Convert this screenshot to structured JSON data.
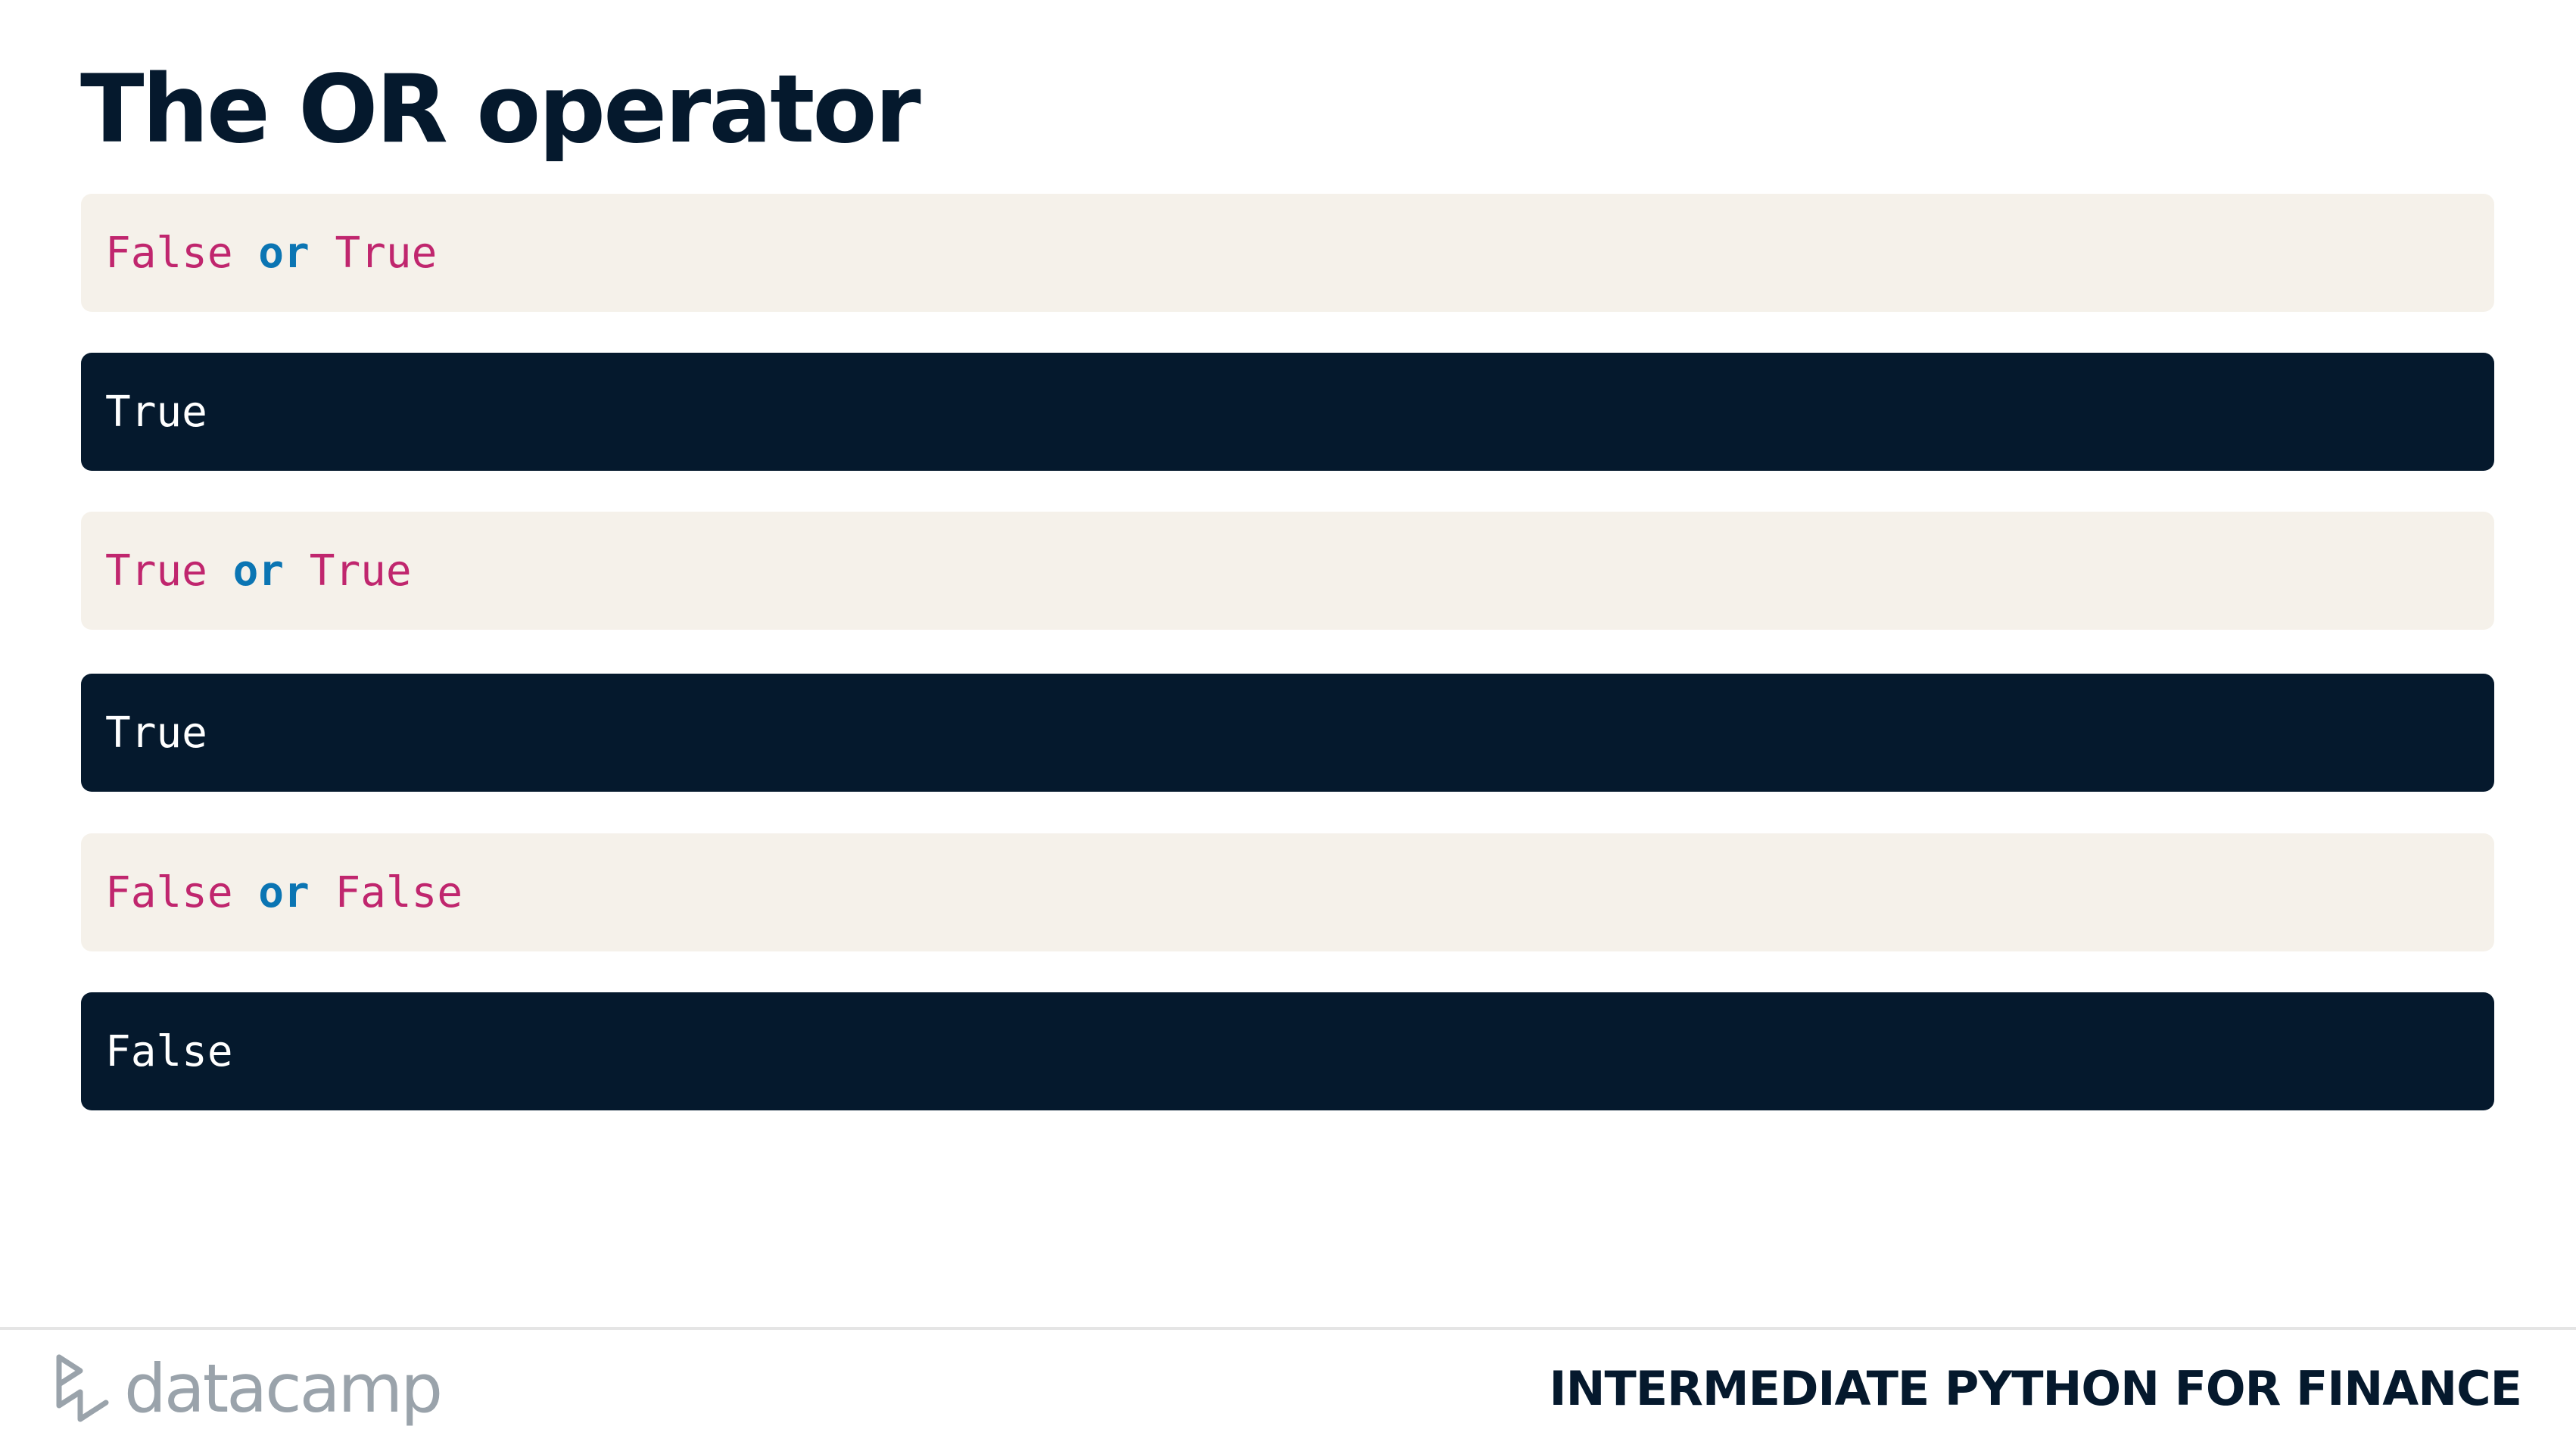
{
  "slide": {
    "title": "The OR operator"
  },
  "blocks": [
    {
      "type": "code",
      "left": "False",
      "op": "or",
      "right": "True"
    },
    {
      "type": "output",
      "text": "True"
    },
    {
      "type": "code",
      "left": "True",
      "op": "or",
      "right": "True"
    },
    {
      "type": "output",
      "text": "True"
    },
    {
      "type": "code",
      "left": "False",
      "op": "or",
      "right": "False"
    },
    {
      "type": "output",
      "text": "False"
    }
  ],
  "footer": {
    "logo_text": "datacamp",
    "logo_icon": "datacamp-logo-icon",
    "course_title": "INTERMEDIATE PYTHON FOR FINANCE"
  },
  "colors": {
    "code_background": "#f5f1ea",
    "output_background": "#05192d",
    "boolean_literal": "#c0266e",
    "keyword": "#0b75b3",
    "title": "#05192d"
  }
}
